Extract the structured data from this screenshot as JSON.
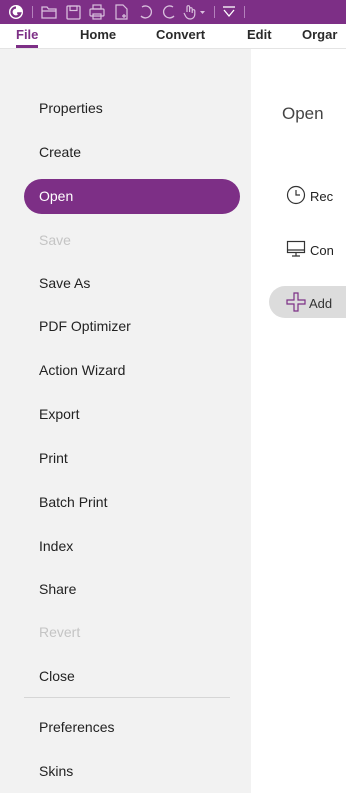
{
  "menubar": {
    "file": "File",
    "home": "Home",
    "convert": "Convert",
    "edit": "Edit",
    "organize": "Orgar"
  },
  "sidebar": {
    "items": [
      {
        "label": "Properties"
      },
      {
        "label": "Create"
      },
      {
        "label": "Open"
      },
      {
        "label": "Save"
      },
      {
        "label": "Save As"
      },
      {
        "label": "PDF Optimizer"
      },
      {
        "label": "Action Wizard"
      },
      {
        "label": "Export"
      },
      {
        "label": "Print"
      },
      {
        "label": "Batch Print"
      },
      {
        "label": "Index"
      },
      {
        "label": "Share"
      },
      {
        "label": "Revert"
      },
      {
        "label": "Close"
      },
      {
        "label": "Preferences"
      },
      {
        "label": "Skins"
      }
    ]
  },
  "content": {
    "title": "Open",
    "recent": "Rec",
    "computer": "Con",
    "add": "Add"
  },
  "colors": {
    "accent": "#7d2f86",
    "sidebar_bg": "#f2f2f2"
  },
  "icons": [
    "app-logo-icon",
    "open-folder-icon",
    "save-icon",
    "print-icon",
    "new-doc-icon",
    "undo-icon",
    "redo-icon",
    "hand-tool-icon",
    "customize-toolbar-icon",
    "clock-icon",
    "monitor-icon",
    "plus-icon"
  ]
}
